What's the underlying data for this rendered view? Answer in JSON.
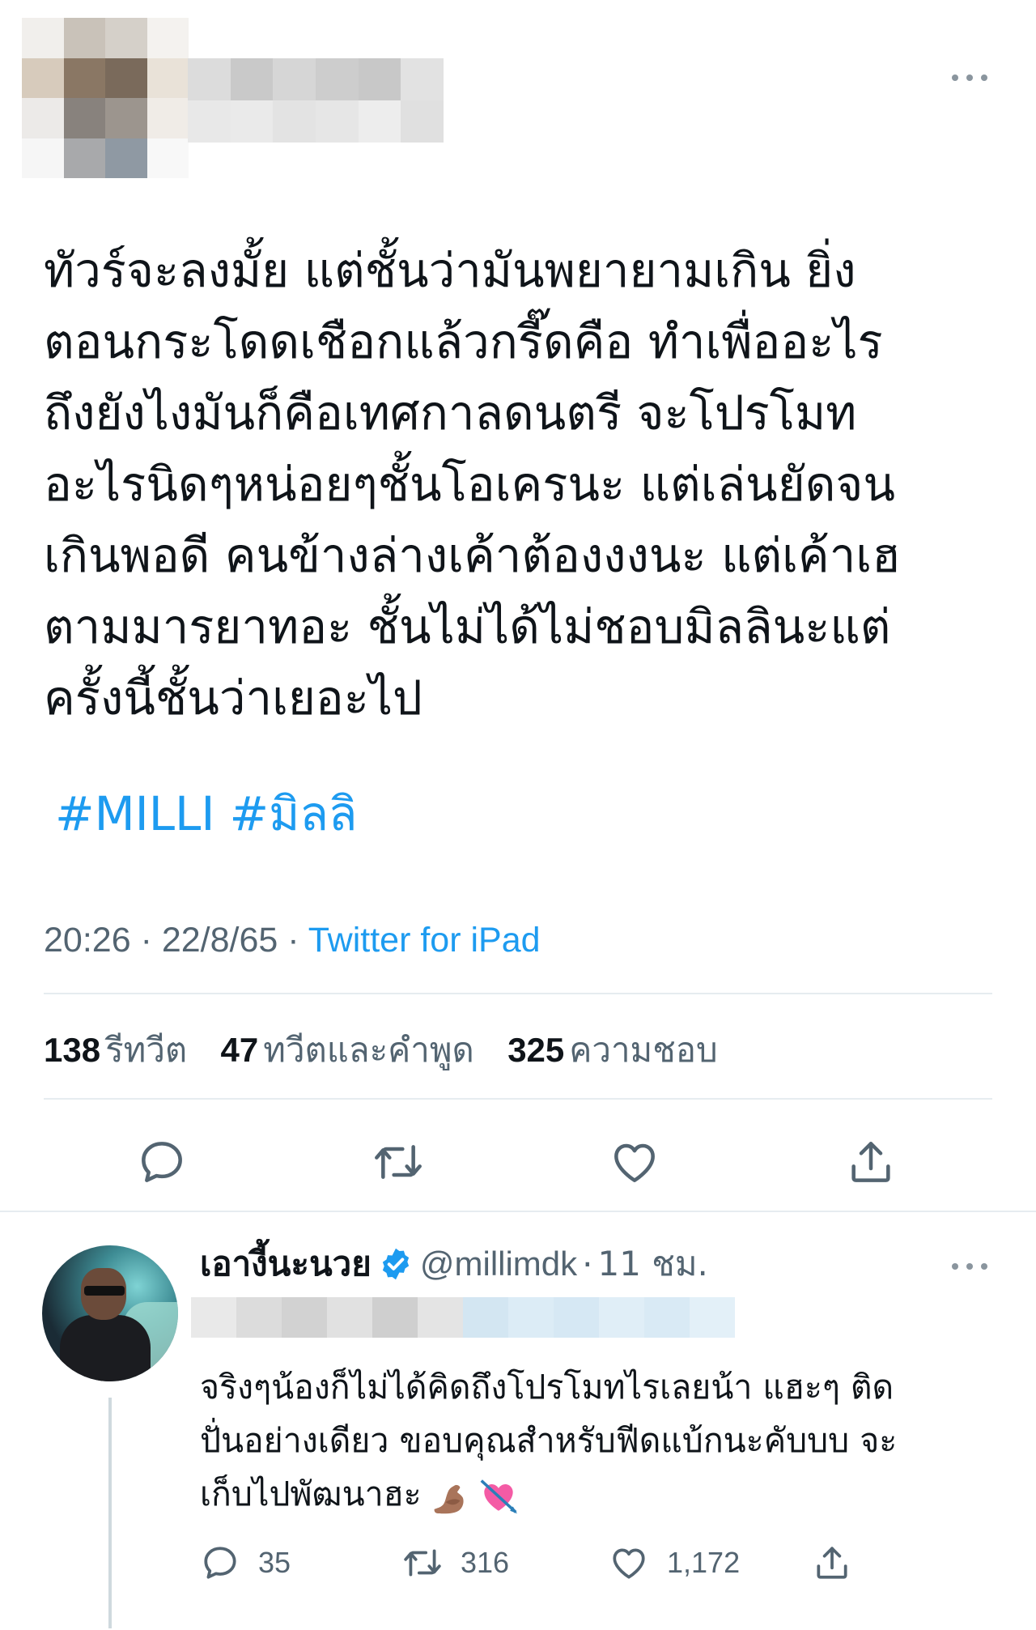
{
  "tweet": {
    "text_lines": [
      "ทัวร์จะลงมั้ย แต่ชั้นว่ามันพยายามเกิน ยิ่ง",
      "ตอนกระโดดเชือกแล้วกรี๊ดคือ ทำเพื่ออะไร",
      "ถึงยังไงมันก็คือเทศกาลดนตรี จะโปรโมท",
      "อะไรนิดๆหน่อยๆชั้นโอเครนะ แต่เล่นยัดจน",
      "เกินพอดี คนข้างล่างเค้าต้องงงนะ แต่เค้าเฮ",
      "ตามมารยาทอะ ชั้นไม่ได้ไม่ชอบมิลลินะแต่",
      "ครั้งนี้ชั้นว่าเยอะไป"
    ],
    "hashtags": [
      "#MILLI",
      "#มิลลิ"
    ],
    "time": "20:26",
    "date": "22/8/65",
    "separator": "·",
    "source": "Twitter for iPad",
    "stats": {
      "retweets": "138",
      "retweets_label": "รีทวีต",
      "quotes": "47",
      "quotes_label": "ทวีตและคำพูด",
      "likes": "325",
      "likes_label": "ความชอบ"
    },
    "icons": [
      "more-icon",
      "reply-icon",
      "retweet-icon",
      "like-icon",
      "share-icon"
    ]
  },
  "reply": {
    "name": "เอางี้นะนวย",
    "handle": "@millimdk",
    "separator": "·",
    "time": "11 ชม.",
    "text_lines": [
      "จริงๆน้องก็ไม่ได้คิดถึงโปรโมทไรเลยน้า แฮะๆ ติด",
      "ปั่นอย่างเดียว ขอบคุณสำหรับฟีดแบ้กนะคับบบ จะ",
      "เก็บไปพัฒนาฮะ"
    ],
    "emojis": [
      "flexed-biceps-emoji",
      "heart-with-arrow-emoji"
    ],
    "counts": {
      "replies": "35",
      "retweets": "316",
      "likes": "1,172"
    }
  },
  "colors": {
    "accent": "#1d9bf0",
    "secondary_text": "#536471",
    "primary_text": "#0f1419",
    "divider": "#e6ecf0"
  }
}
